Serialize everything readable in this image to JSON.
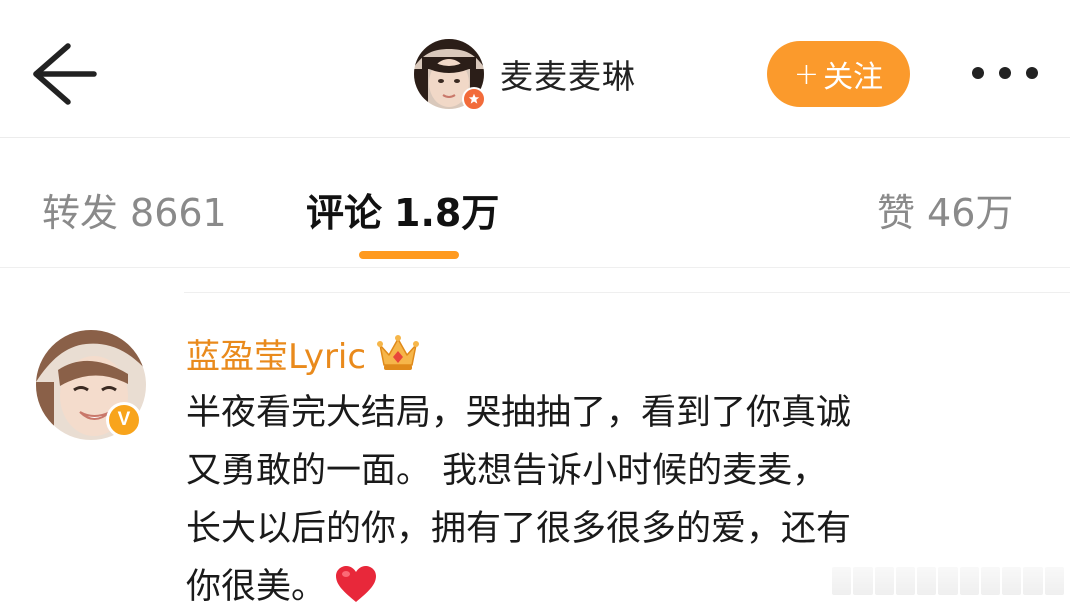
{
  "header": {
    "author_name": "麦麦麦琳",
    "follow_label": "关注",
    "follow_plus": "+"
  },
  "tabs": [
    {
      "label": "转发",
      "count": "8661"
    },
    {
      "label": "评论",
      "count": "1.8万"
    },
    {
      "label": "赞",
      "count": "46万"
    }
  ],
  "comment": {
    "user_name": "蓝盈莹Lyric",
    "badge_letter": "V",
    "lines": [
      "半夜看完大结局，哭抽抽了，看到了你真诚",
      "又勇敢的一面。 我想告诉小时候的麦麦，",
      "长大以后的你，拥有了很多很多的爱，还有",
      "你很美。"
    ],
    "emoji": "heart-icon"
  },
  "colors": {
    "accent_orange": "#fb9a2c",
    "tab_indicator": "#ff9a1f",
    "username_orange": "#e98a1c",
    "muted_gray": "#8a8a8a"
  }
}
